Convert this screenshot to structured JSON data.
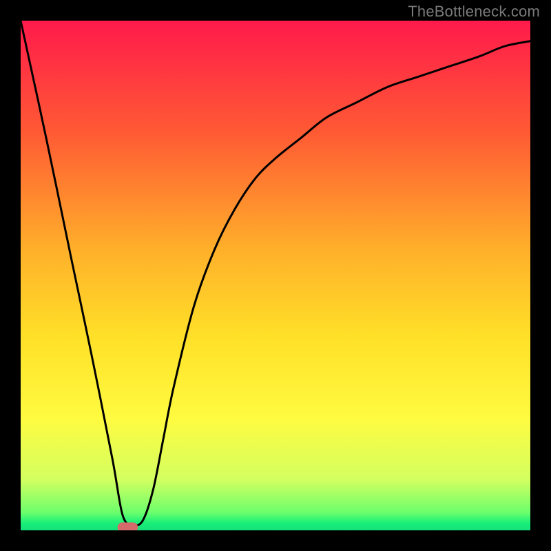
{
  "attribution": "TheBottleneck.com",
  "chart_data": {
    "type": "line",
    "title": "",
    "xlabel": "",
    "ylabel": "",
    "xlim": [
      0,
      100
    ],
    "ylim": [
      0,
      100
    ],
    "grid": false,
    "legend": false,
    "series": [
      {
        "name": "bottleneck-curve",
        "x": [
          0,
          5,
          10,
          14,
          18,
          20,
          22,
          24,
          26,
          28,
          30,
          34,
          38,
          42,
          46,
          50,
          55,
          60,
          66,
          72,
          78,
          84,
          90,
          95,
          100
        ],
        "y": [
          100,
          77,
          53,
          34,
          14,
          3,
          1,
          2,
          8,
          18,
          28,
          44,
          55,
          63,
          69,
          73,
          77,
          81,
          84,
          87,
          89,
          91,
          93,
          95,
          96
        ]
      }
    ],
    "marker": {
      "x_center": 21,
      "width": 4,
      "y": 0.6
    },
    "gradient_stops": [
      {
        "offset": 0.0,
        "color": "#ff1a4b"
      },
      {
        "offset": 0.22,
        "color": "#ff5a34"
      },
      {
        "offset": 0.45,
        "color": "#ffb02a"
      },
      {
        "offset": 0.62,
        "color": "#ffe028"
      },
      {
        "offset": 0.78,
        "color": "#fffb40"
      },
      {
        "offset": 0.9,
        "color": "#d3ff60"
      },
      {
        "offset": 0.965,
        "color": "#6cff6c"
      },
      {
        "offset": 0.985,
        "color": "#1af078"
      },
      {
        "offset": 1.0,
        "color": "#14e07a"
      }
    ]
  }
}
